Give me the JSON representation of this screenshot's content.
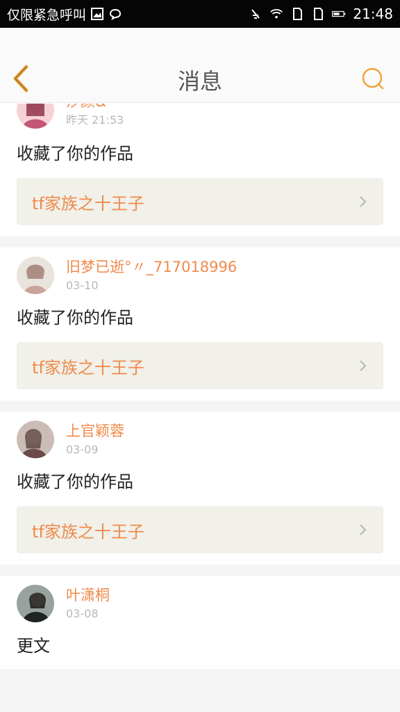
{
  "status_bar": {
    "left_text": "仅限紧急呼叫",
    "time": "21:48",
    "icons": [
      "gallery-icon",
      "chat-bubble-icon",
      "vibrate-off-icon",
      "wifi-icon",
      "sim-icon",
      "sim-icon",
      "battery-icon"
    ]
  },
  "header": {
    "title": "消息",
    "back_icon": "back-chevron-icon",
    "search_icon": "search-icon",
    "accent": "#f0a33a"
  },
  "messages": [
    {
      "username": "汐颜&",
      "time": "昨天 21:53",
      "action": "收藏了你的作品",
      "work": "tf家族之十王子",
      "avatar_colors": [
        "#f6d2d8",
        "#c35577"
      ]
    },
    {
      "username": "旧梦已逝°〃_717018996",
      "time": "03-10",
      "action": "收藏了你的作品",
      "work": "tf家族之十王子",
      "avatar_colors": [
        "#e8e3dc",
        "#c9a49a"
      ]
    },
    {
      "username": "上官颖蓉",
      "time": "03-09",
      "action": "收藏了你的作品",
      "work": "tf家族之十王子",
      "avatar_colors": [
        "#cbbcb6",
        "#6b4a49"
      ]
    },
    {
      "username": "叶潇桐",
      "time": "03-08",
      "action": "更文",
      "work": "",
      "avatar_colors": [
        "#9aa29e",
        "#1f2321"
      ]
    }
  ],
  "colors": {
    "username": "#f08a4b",
    "card_bg": "#f1f0e9"
  }
}
